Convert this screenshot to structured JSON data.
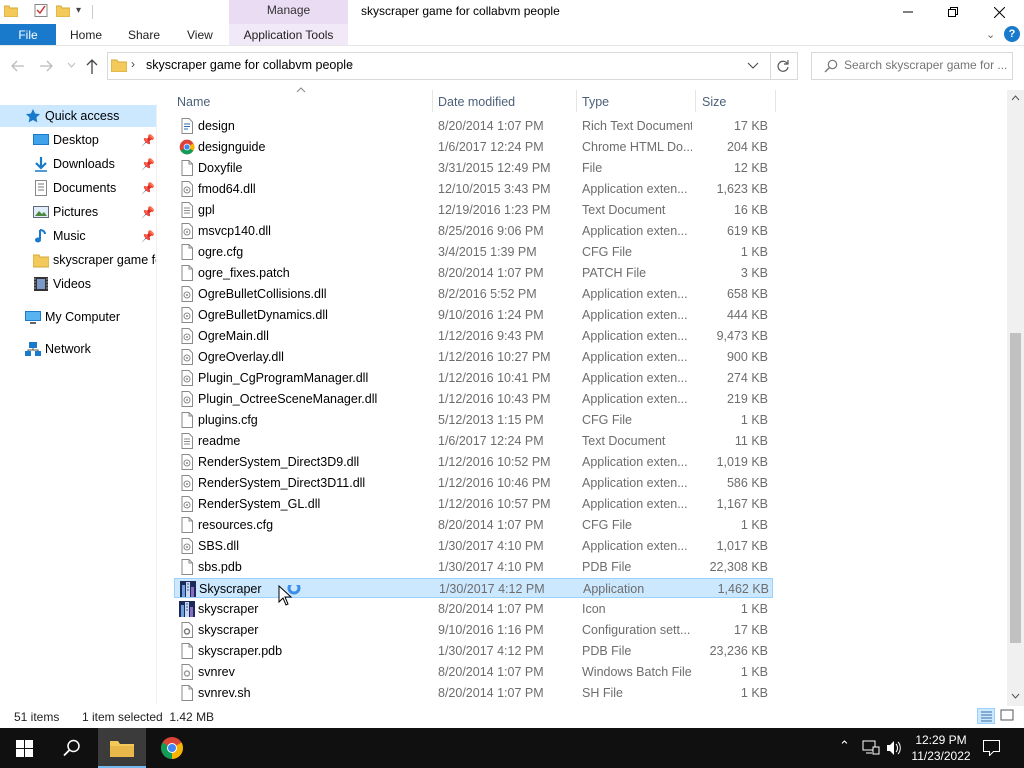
{
  "window": {
    "title": "skyscraper game for collabvm people",
    "contextual_group": "Manage"
  },
  "ribbon": {
    "tabs": [
      "File",
      "Home",
      "Share",
      "View",
      "Application Tools"
    ],
    "help_label": "?"
  },
  "address": {
    "path": "skyscraper game for collabvm people",
    "search_placeholder": "Search skyscraper game for ..."
  },
  "nav": {
    "items": [
      {
        "label": "Quick access",
        "icon": "star-icon",
        "pinned": false
      },
      {
        "label": "Desktop",
        "icon": "desktop-icon",
        "pinned": true
      },
      {
        "label": "Downloads",
        "icon": "download-arrow-icon",
        "pinned": true
      },
      {
        "label": "Documents",
        "icon": "documents-icon",
        "pinned": true
      },
      {
        "label": "Pictures",
        "icon": "pictures-icon",
        "pinned": true
      },
      {
        "label": "Music",
        "icon": "music-note-icon",
        "pinned": true
      },
      {
        "label": "skyscraper game fo",
        "icon": "folder-icon",
        "pinned": false
      },
      {
        "label": "Videos",
        "icon": "film-icon",
        "pinned": false
      },
      {
        "label": "My Computer",
        "icon": "computer-icon",
        "pinned": false
      },
      {
        "label": "Network",
        "icon": "network-icon",
        "pinned": false
      }
    ]
  },
  "columns": {
    "name": "Name",
    "date": "Date modified",
    "type": "Type",
    "size": "Size"
  },
  "files": [
    {
      "name": "design",
      "date": "8/20/2014 1:07 PM",
      "type": "Rich Text Document",
      "size": "17 KB",
      "icon": "rtf-icon"
    },
    {
      "name": "designguide",
      "date": "1/6/2017 12:24 PM",
      "type": "Chrome HTML Do...",
      "size": "204 KB",
      "icon": "chrome-icon"
    },
    {
      "name": "Doxyfile",
      "date": "3/31/2015 12:49 PM",
      "type": "File",
      "size": "12 KB",
      "icon": "file-icon"
    },
    {
      "name": "fmod64.dll",
      "date": "12/10/2015 3:43 PM",
      "type": "Application exten...",
      "size": "1,623 KB",
      "icon": "dll-icon"
    },
    {
      "name": "gpl",
      "date": "12/19/2016 1:23 PM",
      "type": "Text Document",
      "size": "16 KB",
      "icon": "text-icon"
    },
    {
      "name": "msvcp140.dll",
      "date": "8/25/2016 9:06 PM",
      "type": "Application exten...",
      "size": "619 KB",
      "icon": "dll-icon"
    },
    {
      "name": "ogre.cfg",
      "date": "3/4/2015 1:39 PM",
      "type": "CFG File",
      "size": "1 KB",
      "icon": "file-icon"
    },
    {
      "name": "ogre_fixes.patch",
      "date": "8/20/2014 1:07 PM",
      "type": "PATCH File",
      "size": "3 KB",
      "icon": "file-icon"
    },
    {
      "name": "OgreBulletCollisions.dll",
      "date": "8/2/2016 5:52 PM",
      "type": "Application exten...",
      "size": "658 KB",
      "icon": "dll-icon"
    },
    {
      "name": "OgreBulletDynamics.dll",
      "date": "9/10/2016 1:24 PM",
      "type": "Application exten...",
      "size": "444 KB",
      "icon": "dll-icon"
    },
    {
      "name": "OgreMain.dll",
      "date": "1/12/2016 9:43 PM",
      "type": "Application exten...",
      "size": "9,473 KB",
      "icon": "dll-icon"
    },
    {
      "name": "OgreOverlay.dll",
      "date": "1/12/2016 10:27 PM",
      "type": "Application exten...",
      "size": "900 KB",
      "icon": "dll-icon"
    },
    {
      "name": "Plugin_CgProgramManager.dll",
      "date": "1/12/2016 10:41 PM",
      "type": "Application exten...",
      "size": "274 KB",
      "icon": "dll-icon"
    },
    {
      "name": "Plugin_OctreeSceneManager.dll",
      "date": "1/12/2016 10:43 PM",
      "type": "Application exten...",
      "size": "219 KB",
      "icon": "dll-icon"
    },
    {
      "name": "plugins.cfg",
      "date": "5/12/2013 1:15 PM",
      "type": "CFG File",
      "size": "1 KB",
      "icon": "file-icon"
    },
    {
      "name": "readme",
      "date": "1/6/2017 12:24 PM",
      "type": "Text Document",
      "size": "11 KB",
      "icon": "text-icon"
    },
    {
      "name": "RenderSystem_Direct3D9.dll",
      "date": "1/12/2016 10:52 PM",
      "type": "Application exten...",
      "size": "1,019 KB",
      "icon": "dll-icon"
    },
    {
      "name": "RenderSystem_Direct3D11.dll",
      "date": "1/12/2016 10:46 PM",
      "type": "Application exten...",
      "size": "586 KB",
      "icon": "dll-icon"
    },
    {
      "name": "RenderSystem_GL.dll",
      "date": "1/12/2016 10:57 PM",
      "type": "Application exten...",
      "size": "1,167 KB",
      "icon": "dll-icon"
    },
    {
      "name": "resources.cfg",
      "date": "8/20/2014 1:07 PM",
      "type": "CFG File",
      "size": "1 KB",
      "icon": "file-icon"
    },
    {
      "name": "SBS.dll",
      "date": "1/30/2017 4:10 PM",
      "type": "Application exten...",
      "size": "1,017 KB",
      "icon": "dll-icon"
    },
    {
      "name": "sbs.pdb",
      "date": "1/30/2017 4:10 PM",
      "type": "PDB File",
      "size": "22,308 KB",
      "icon": "file-icon"
    },
    {
      "name": "Skyscraper",
      "date": "1/30/2017 4:12 PM",
      "type": "Application",
      "size": "1,462 KB",
      "icon": "skyscraper-app-icon",
      "selected": true
    },
    {
      "name": "skyscraper",
      "date": "8/20/2014 1:07 PM",
      "type": "Icon",
      "size": "1 KB",
      "icon": "skyscraper-app-icon"
    },
    {
      "name": "skyscraper",
      "date": "9/10/2016 1:16 PM",
      "type": "Configuration sett...",
      "size": "17 KB",
      "icon": "config-icon"
    },
    {
      "name": "skyscraper.pdb",
      "date": "1/30/2017 4:12 PM",
      "type": "PDB File",
      "size": "23,236 KB",
      "icon": "file-icon"
    },
    {
      "name": "svnrev",
      "date": "8/20/2014 1:07 PM",
      "type": "Windows Batch File",
      "size": "1 KB",
      "icon": "batch-icon"
    },
    {
      "name": "svnrev.sh",
      "date": "8/20/2014 1:07 PM",
      "type": "SH File",
      "size": "1 KB",
      "icon": "file-icon"
    }
  ],
  "status": {
    "item_count": "51 items",
    "selection": "1 item selected  1.42 MB"
  },
  "taskbar": {
    "time": "12:29 PM",
    "date": "11/23/2022"
  },
  "colors": {
    "accent": "#1979ca",
    "selection_bg": "#cce8ff",
    "selection_border": "#99d1ff",
    "contextual_tab": "#e9dcf3",
    "taskbar": "#101010"
  }
}
